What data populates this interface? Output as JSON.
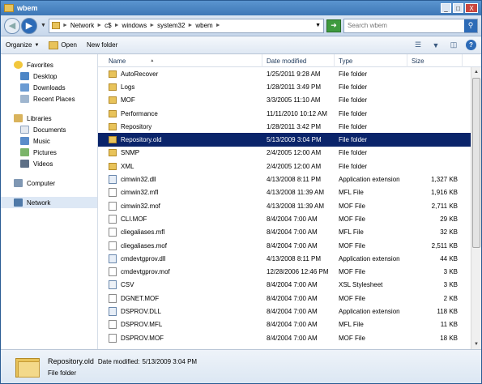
{
  "window": {
    "title": "wbem",
    "controls": {
      "minimize": "_",
      "maximize": "□",
      "close": "X"
    }
  },
  "address": {
    "crumbs": [
      "Network",
      "c$",
      "windows",
      "system32",
      "wbem"
    ],
    "search_placeholder": "Search wbem"
  },
  "toolbar": {
    "organize": "Organize",
    "open": "Open",
    "new_folder": "New folder"
  },
  "nav": {
    "favorites": {
      "label": "Favorites",
      "items": [
        "Desktop",
        "Downloads",
        "Recent Places"
      ]
    },
    "libraries": {
      "label": "Libraries",
      "items": [
        "Documents",
        "Music",
        "Pictures",
        "Videos"
      ]
    },
    "computer": "Computer",
    "network": "Network"
  },
  "columns": {
    "name": "Name",
    "date": "Date modified",
    "type": "Type",
    "size": "Size"
  },
  "files": [
    {
      "name": "AutoRecover",
      "date": "1/25/2011 9:28 AM",
      "type": "File folder",
      "size": "",
      "icon": "folder"
    },
    {
      "name": "Logs",
      "date": "1/28/2011 3:49 PM",
      "type": "File folder",
      "size": "",
      "icon": "folder"
    },
    {
      "name": "MOF",
      "date": "3/3/2005 11:10 AM",
      "type": "File folder",
      "size": "",
      "icon": "folder"
    },
    {
      "name": "Performance",
      "date": "11/11/2010 10:12 AM",
      "type": "File folder",
      "size": "",
      "icon": "folder"
    },
    {
      "name": "Repository",
      "date": "1/28/2011 3:42 PM",
      "type": "File folder",
      "size": "",
      "icon": "folder"
    },
    {
      "name": "Repository.old",
      "date": "5/13/2009 3:04 PM",
      "type": "File folder",
      "size": "",
      "icon": "folder",
      "selected": true
    },
    {
      "name": "SNMP",
      "date": "2/4/2005 12:00 AM",
      "type": "File folder",
      "size": "",
      "icon": "folder"
    },
    {
      "name": "XML",
      "date": "2/4/2005 12:00 AM",
      "type": "File folder",
      "size": "",
      "icon": "folder"
    },
    {
      "name": "cimwin32.dll",
      "date": "4/13/2008 8:11 PM",
      "type": "Application extension",
      "size": "1,327 KB",
      "icon": "dll"
    },
    {
      "name": "cimwin32.mfl",
      "date": "4/13/2008 11:39 AM",
      "type": "MFL File",
      "size": "1,916 KB",
      "icon": "file"
    },
    {
      "name": "cimwin32.mof",
      "date": "4/13/2008 11:39 AM",
      "type": "MOF File",
      "size": "2,711 KB",
      "icon": "file"
    },
    {
      "name": "CLI.MOF",
      "date": "8/4/2004 7:00 AM",
      "type": "MOF File",
      "size": "29 KB",
      "icon": "file"
    },
    {
      "name": "cliegaliases.mfl",
      "date": "8/4/2004 7:00 AM",
      "type": "MFL File",
      "size": "32 KB",
      "icon": "file"
    },
    {
      "name": "cliegaliases.mof",
      "date": "8/4/2004 7:00 AM",
      "type": "MOF File",
      "size": "2,511 KB",
      "icon": "file"
    },
    {
      "name": "cmdevtgprov.dll",
      "date": "4/13/2008 8:11 PM",
      "type": "Application extension",
      "size": "44 KB",
      "icon": "dll"
    },
    {
      "name": "cmdevtgprov.mof",
      "date": "12/28/2006 12:46 PM",
      "type": "MOF File",
      "size": "3 KB",
      "icon": "file"
    },
    {
      "name": "CSV",
      "date": "8/4/2004 7:00 AM",
      "type": "XSL Stylesheet",
      "size": "3 KB",
      "icon": "css"
    },
    {
      "name": "DGNET.MOF",
      "date": "8/4/2004 7:00 AM",
      "type": "MOF File",
      "size": "2 KB",
      "icon": "file"
    },
    {
      "name": "DSPROV.DLL",
      "date": "8/4/2004 7:00 AM",
      "type": "Application extension",
      "size": "118 KB",
      "icon": "dll"
    },
    {
      "name": "DSPROV.MFL",
      "date": "8/4/2004 7:00 AM",
      "type": "MFL File",
      "size": "11 KB",
      "icon": "file"
    },
    {
      "name": "DSPROV.MOF",
      "date": "8/4/2004 7:00 AM",
      "type": "MOF File",
      "size": "18 KB",
      "icon": "file"
    }
  ],
  "details": {
    "name": "Repository.old",
    "date_label": "Date modified:",
    "date": "5/13/2009 3:04 PM",
    "type": "File folder"
  },
  "colors": {
    "selection": "#0a246a",
    "titlebar": "#3d77b6",
    "folder": "#e8c35a"
  }
}
